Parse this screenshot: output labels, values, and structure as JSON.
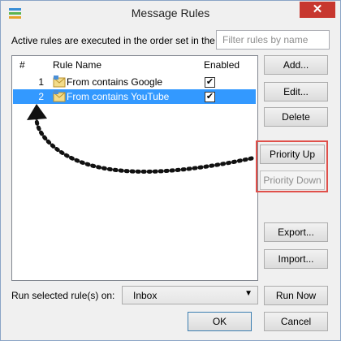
{
  "window": {
    "title": "Message Rules",
    "close_glyph": "✕"
  },
  "header": {
    "active_label": "Active rules are executed in the order set in the",
    "filter_placeholder": "Filter rules by name"
  },
  "table": {
    "columns": [
      "#",
      "Rule Name",
      "Enabled"
    ],
    "rows": [
      {
        "num": "1",
        "name": "From contains Google",
        "enabled": true,
        "selected": false
      },
      {
        "num": "2",
        "name": "From contains YouTube",
        "enabled": true,
        "selected": true
      }
    ],
    "check_glyph": "✔"
  },
  "buttons": {
    "add": "Add...",
    "edit": "Edit...",
    "delete": "Delete",
    "priority_up": "Priority Up",
    "priority_down": "Priority Down",
    "export": "Export...",
    "import": "Import...",
    "run_now": "Run Now",
    "ok": "OK",
    "cancel": "Cancel"
  },
  "run": {
    "label": "Run selected rule(s) on:",
    "selected_folder": "Inbox",
    "arrow_glyph": "▼"
  },
  "annotation": {
    "highlight_color": "#e0504a"
  }
}
